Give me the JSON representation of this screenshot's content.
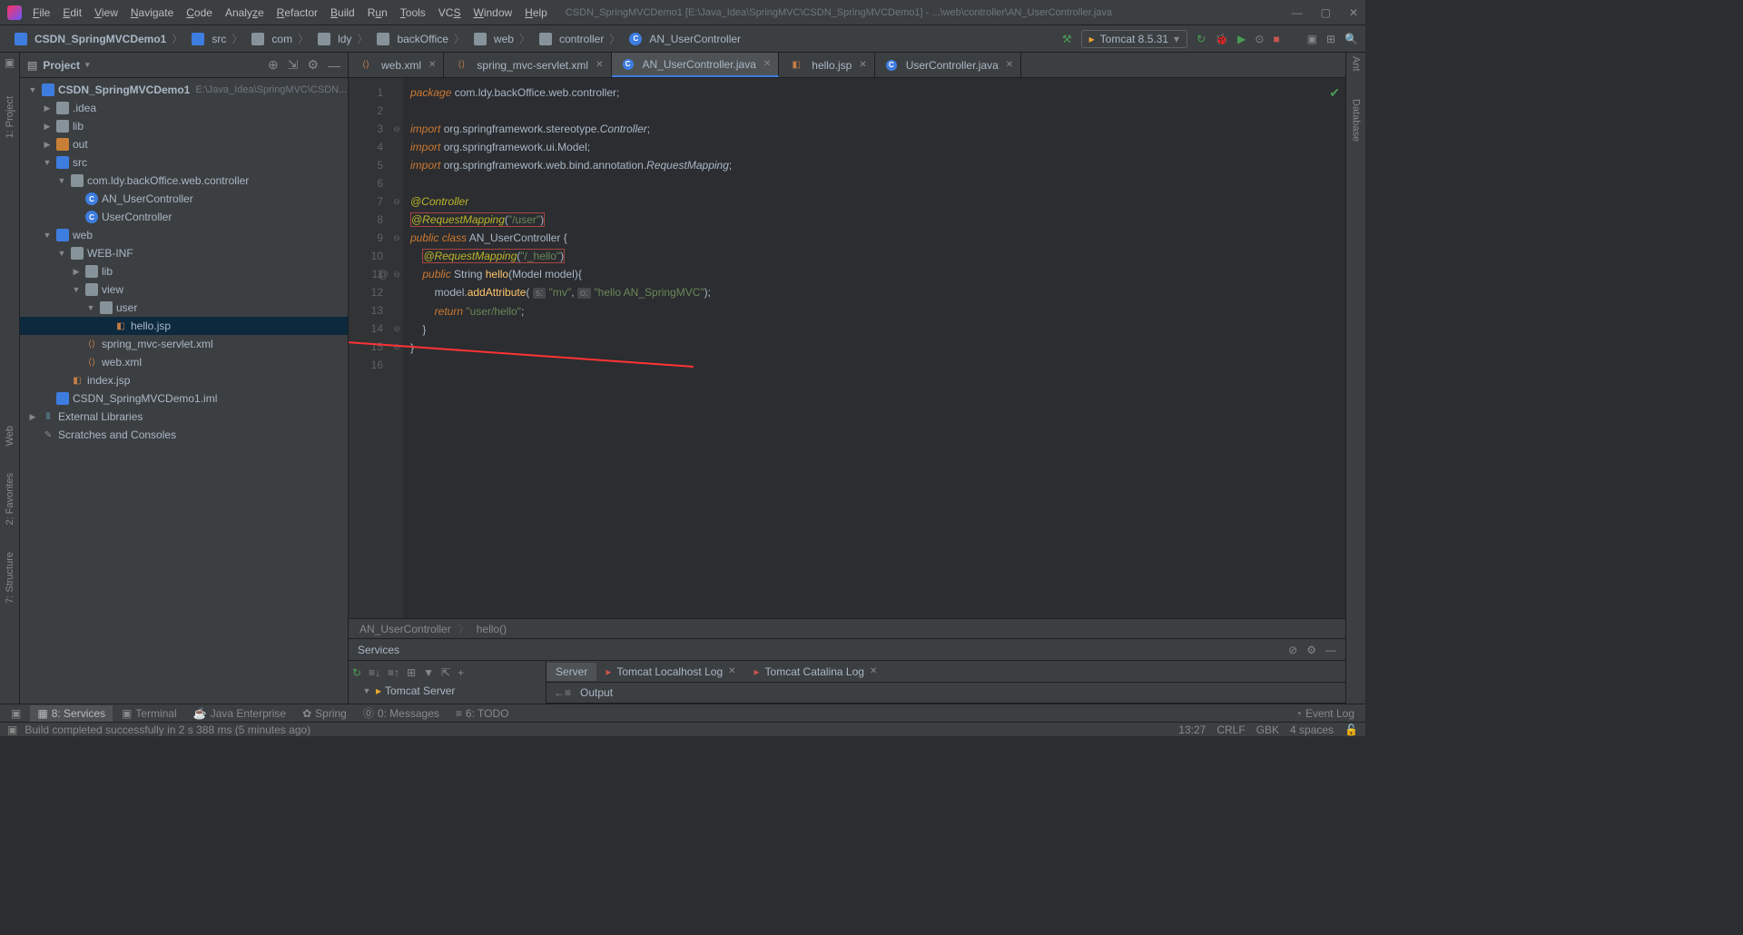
{
  "window": {
    "title": "CSDN_SpringMVCDemo1 [E:\\Java_Idea\\SpringMVC\\CSDN_SpringMVCDemo1] - ...\\web\\controller\\AN_UserController.java"
  },
  "menu": [
    "File",
    "Edit",
    "View",
    "Navigate",
    "Code",
    "Analyze",
    "Refactor",
    "Build",
    "Run",
    "Tools",
    "VCS",
    "Window",
    "Help"
  ],
  "breadcrumbs": [
    "CSDN_SpringMVCDemo1",
    "src",
    "com",
    "ldy",
    "backOffice",
    "web",
    "controller",
    "AN_UserController"
  ],
  "run_config": "Tomcat 8.5.31",
  "project_panel": {
    "title": "Project",
    "root": {
      "name": "CSDN_SpringMVCDemo1",
      "path": "E:\\Java_Idea\\SpringMVC\\CSDN..."
    },
    "nodes": [
      {
        "indent": 1,
        "exp": "▶",
        "icon": "folder",
        "name": ".idea"
      },
      {
        "indent": 1,
        "exp": "▶",
        "icon": "folder",
        "name": "lib"
      },
      {
        "indent": 1,
        "exp": "▶",
        "icon": "folder orange",
        "name": "out"
      },
      {
        "indent": 1,
        "exp": "▼",
        "icon": "folder blue",
        "name": "src"
      },
      {
        "indent": 2,
        "exp": "▼",
        "icon": "folder",
        "name": "com.ldy.backOffice.web.controller"
      },
      {
        "indent": 3,
        "exp": "",
        "icon": "java",
        "name": "AN_UserController",
        "iconTxt": "C"
      },
      {
        "indent": 3,
        "exp": "",
        "icon": "java",
        "name": "UserController",
        "iconTxt": "C"
      },
      {
        "indent": 1,
        "exp": "▼",
        "icon": "folder blue",
        "name": "web"
      },
      {
        "indent": 2,
        "exp": "▼",
        "icon": "folder",
        "name": "WEB-INF"
      },
      {
        "indent": 3,
        "exp": "▶",
        "icon": "folder",
        "name": "lib"
      },
      {
        "indent": 3,
        "exp": "▼",
        "icon": "folder",
        "name": "view"
      },
      {
        "indent": 4,
        "exp": "▼",
        "icon": "folder",
        "name": "user"
      },
      {
        "indent": 5,
        "exp": "",
        "icon": "jsp",
        "name": "hello.jsp",
        "sel": true
      },
      {
        "indent": 3,
        "exp": "",
        "icon": "xml",
        "name": "spring_mvc-servlet.xml"
      },
      {
        "indent": 3,
        "exp": "",
        "icon": "xml",
        "name": "web.xml"
      },
      {
        "indent": 2,
        "exp": "",
        "icon": "jsp",
        "name": "index.jsp"
      },
      {
        "indent": 1,
        "exp": "",
        "icon": "mod",
        "name": "CSDN_SpringMVCDemo1.iml"
      },
      {
        "indent": 0,
        "exp": "▶",
        "icon": "lib",
        "name": "External Libraries"
      },
      {
        "indent": 0,
        "exp": "",
        "icon": "scratch",
        "name": "Scratches and Consoles"
      }
    ]
  },
  "tabs": [
    {
      "icon": "xml",
      "label": "web.xml"
    },
    {
      "icon": "xml",
      "label": "spring_mvc-servlet.xml"
    },
    {
      "icon": "java",
      "label": "AN_UserController.java",
      "active": true
    },
    {
      "icon": "jsp",
      "label": "hello.jsp"
    },
    {
      "icon": "java",
      "label": "UserController.java"
    }
  ],
  "code": {
    "lines": [
      1,
      2,
      3,
      4,
      5,
      6,
      7,
      8,
      9,
      10,
      11,
      12,
      13,
      14,
      15,
      16
    ],
    "pkg": "com.ldy.backOffice.web.controller",
    "imports": [
      "org.springframework.stereotype.",
      "org.springframework.ui.Model",
      "org.springframework.web.bind.annotation."
    ],
    "imp_cls": [
      "Controller",
      "RequestMapping"
    ],
    "ann1": "@Controller",
    "ann2": "@RequestMapping",
    "ann2_arg": "\"/user\"",
    "ann3": "@RequestMapping",
    "ann3_arg": "\"/_hello\"",
    "class_name": "AN_UserController",
    "method": "hello",
    "param_type": "Model",
    "param_name": "model",
    "call": "addAttribute",
    "hint1": "s:",
    "arg1": "\"mv\"",
    "hint2": "o:",
    "arg2": "\"hello AN_SpringMVC\"",
    "ret": "\"user/hello\""
  },
  "crumbs": [
    "AN_UserController",
    "hello()"
  ],
  "services": {
    "title": "Services",
    "tree": "Tomcat Server",
    "tabs": [
      "Server",
      "Tomcat Localhost Log",
      "Tomcat Catalina Log"
    ],
    "output_label": "Output"
  },
  "bottom_tabs": [
    "8: Services",
    "Terminal",
    "Java Enterprise",
    "Spring",
    "0: Messages",
    "6: TODO"
  ],
  "event_log": "Event Log",
  "status": {
    "msg": "Build completed successfully in 2 s 388 ms (5 minutes ago)",
    "time": "13:27",
    "eol": "CRLF",
    "enc": "GBK",
    "indent": "4 spaces"
  },
  "left_tools": [
    "1: Project",
    "Web",
    "2: Favorites",
    "7: Structure"
  ],
  "right_tools": [
    "Ant",
    "Database"
  ]
}
